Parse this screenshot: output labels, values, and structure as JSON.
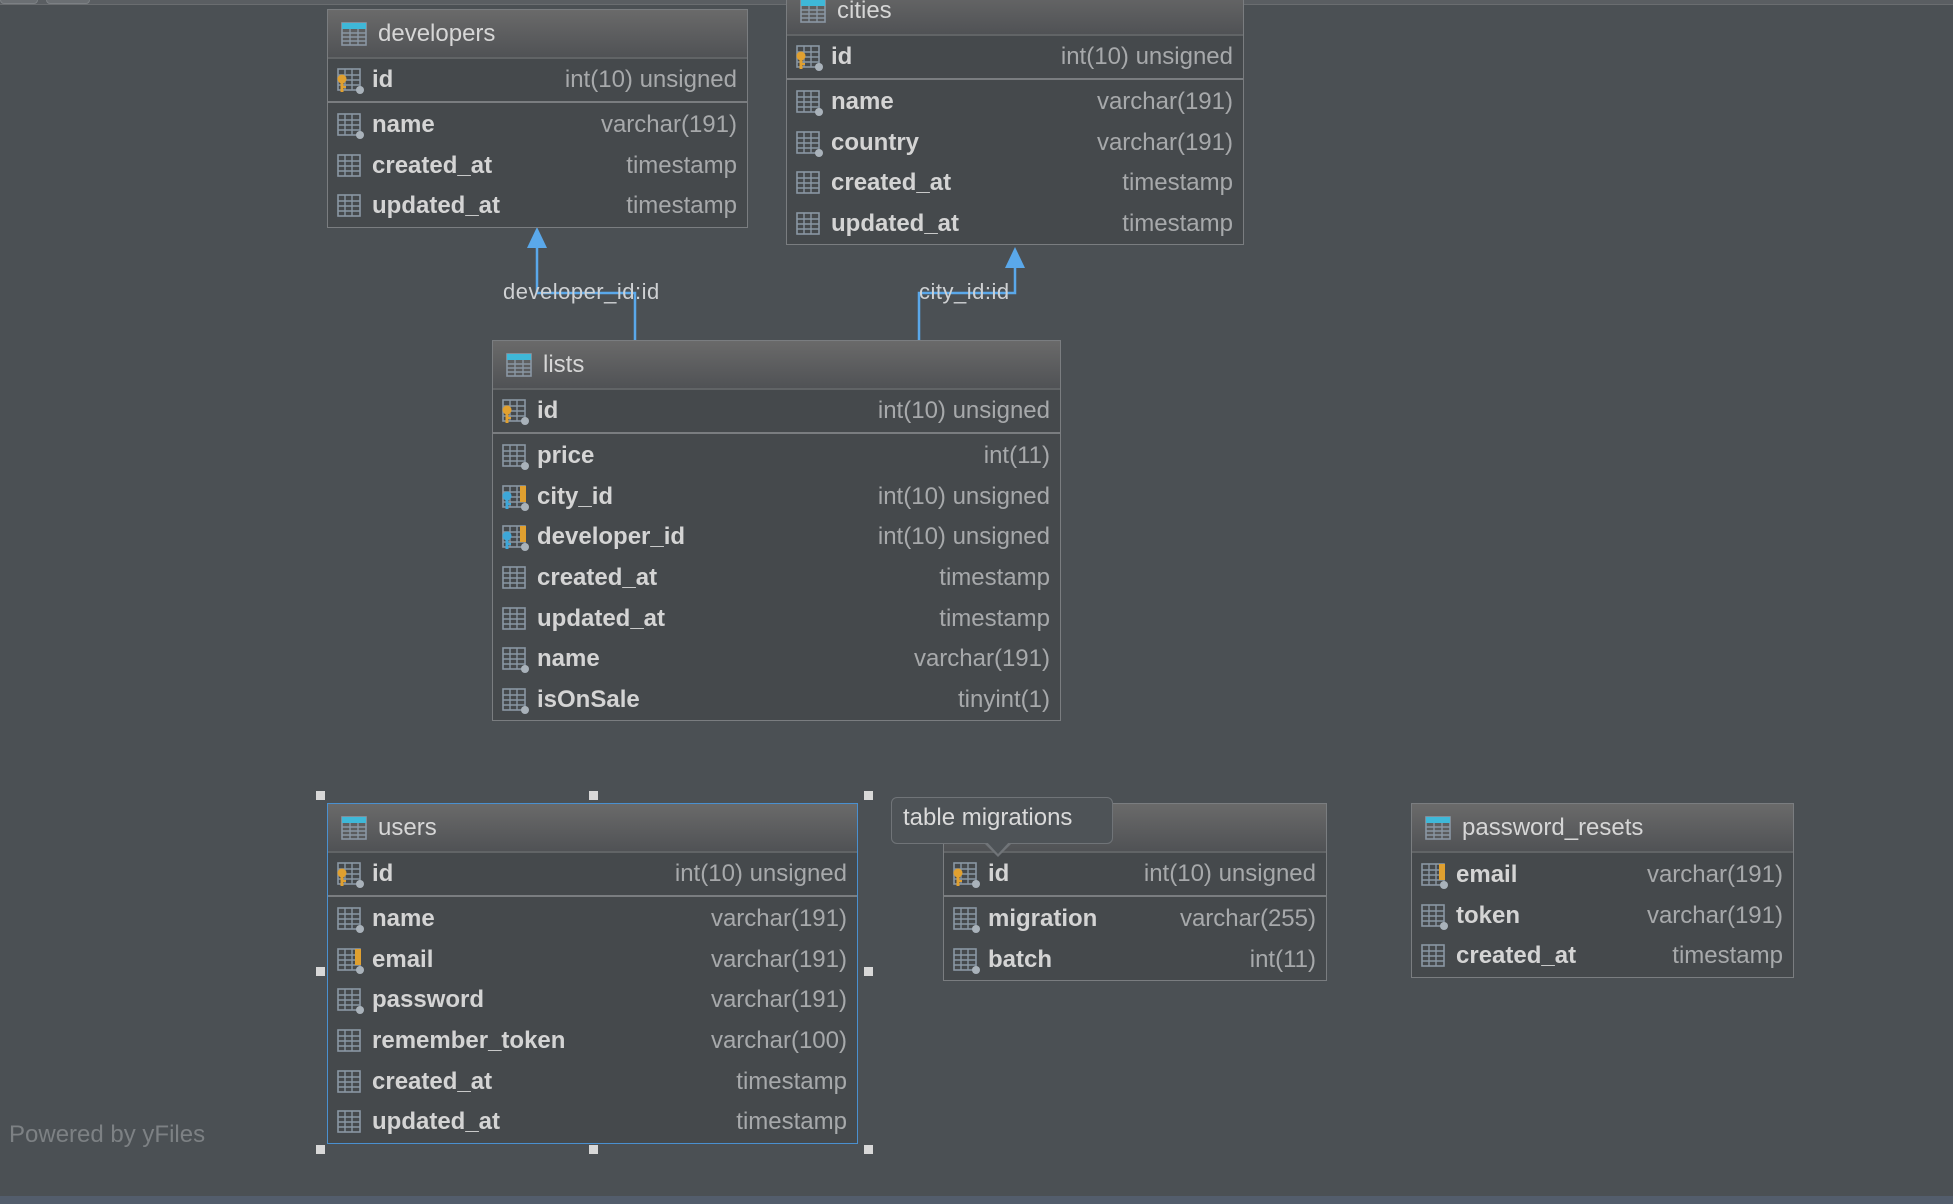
{
  "diagram": {
    "footer": "Powered by yFiles",
    "tooltip": "table migrations",
    "colors": {
      "background": "#4b5054",
      "edge": "#5aa8ea",
      "table_icon_accent": "#3fb8d8",
      "pk_key": "#e0a030",
      "fk_key": "#3ea7d8",
      "selection": "#4a90d0"
    },
    "relations": [
      {
        "label": "developer_id:id",
        "from": "lists.developer_id",
        "to": "developers.id"
      },
      {
        "label": "city_id:id",
        "from": "lists.city_id",
        "to": "cities.id"
      }
    ],
    "tables": {
      "developers": {
        "name": "developers",
        "pk": {
          "name": "id",
          "type": "int(10) unsigned",
          "icon": "primary-key-column-icon"
        },
        "columns": [
          {
            "name": "name",
            "type": "varchar(191)",
            "icon": "not-null-column-icon"
          },
          {
            "name": "created_at",
            "type": "timestamp",
            "icon": "column-icon"
          },
          {
            "name": "updated_at",
            "type": "timestamp",
            "icon": "column-icon"
          }
        ]
      },
      "cities": {
        "name": "cities",
        "pk": {
          "name": "id",
          "type": "int(10) unsigned",
          "icon": "primary-key-column-icon"
        },
        "columns": [
          {
            "name": "name",
            "type": "varchar(191)",
            "icon": "not-null-column-icon"
          },
          {
            "name": "country",
            "type": "varchar(191)",
            "icon": "not-null-column-icon"
          },
          {
            "name": "created_at",
            "type": "timestamp",
            "icon": "column-icon"
          },
          {
            "name": "updated_at",
            "type": "timestamp",
            "icon": "column-icon"
          }
        ]
      },
      "lists": {
        "name": "lists",
        "pk": {
          "name": "id",
          "type": "int(10) unsigned",
          "icon": "primary-key-column-icon"
        },
        "columns": [
          {
            "name": "price",
            "type": "int(11)",
            "icon": "not-null-column-icon"
          },
          {
            "name": "city_id",
            "type": "int(10) unsigned",
            "icon": "foreign-key-column-icon"
          },
          {
            "name": "developer_id",
            "type": "int(10) unsigned",
            "icon": "foreign-key-column-icon"
          },
          {
            "name": "created_at",
            "type": "timestamp",
            "icon": "column-icon"
          },
          {
            "name": "updated_at",
            "type": "timestamp",
            "icon": "column-icon"
          },
          {
            "name": "name",
            "type": "varchar(191)",
            "icon": "not-null-column-icon"
          },
          {
            "name": "isOnSale",
            "type": "tinyint(1)",
            "icon": "not-null-column-icon"
          }
        ]
      },
      "users": {
        "name": "users",
        "selected": true,
        "pk": {
          "name": "id",
          "type": "int(10) unsigned",
          "icon": "primary-key-column-icon"
        },
        "columns": [
          {
            "name": "name",
            "type": "varchar(191)",
            "icon": "not-null-column-icon"
          },
          {
            "name": "email",
            "type": "varchar(191)",
            "icon": "indexed-column-icon"
          },
          {
            "name": "password",
            "type": "varchar(191)",
            "icon": "not-null-column-icon"
          },
          {
            "name": "remember_token",
            "type": "varchar(100)",
            "icon": "column-icon"
          },
          {
            "name": "created_at",
            "type": "timestamp",
            "icon": "column-icon"
          },
          {
            "name": "updated_at",
            "type": "timestamp",
            "icon": "column-icon"
          }
        ]
      },
      "migrations": {
        "name": "migrations",
        "pk": {
          "name": "id",
          "type": "int(10) unsigned",
          "icon": "primary-key-column-icon"
        },
        "columns": [
          {
            "name": "migration",
            "type": "varchar(255)",
            "icon": "not-null-column-icon"
          },
          {
            "name": "batch",
            "type": "int(11)",
            "icon": "not-null-column-icon"
          }
        ]
      },
      "password_resets": {
        "name": "password_resets",
        "columns": [
          {
            "name": "email",
            "type": "varchar(191)",
            "icon": "indexed-column-icon"
          },
          {
            "name": "token",
            "type": "varchar(191)",
            "icon": "not-null-column-icon"
          },
          {
            "name": "created_at",
            "type": "timestamp",
            "icon": "column-icon"
          }
        ]
      }
    }
  }
}
